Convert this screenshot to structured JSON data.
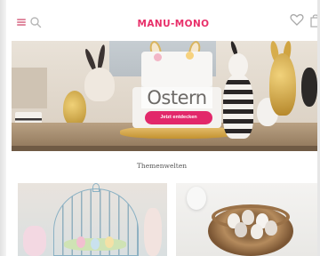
{
  "header": {
    "logo_text": "MANU-MONO",
    "menu_icon": "hamburger-menu-icon",
    "search_icon": "search-icon",
    "wishlist_icon": "heart-icon",
    "cart_icon": "shopping-bag-icon",
    "brand_color": "#e8306a"
  },
  "hero": {
    "title": "Ostern",
    "button_label": "Jetzt entdecken",
    "button_color": "#e2286a"
  },
  "section": {
    "title": "Themenwelten"
  },
  "tiles": [
    {
      "name": "birdcage-easter-decor"
    },
    {
      "name": "nest-with-eggs"
    }
  ]
}
